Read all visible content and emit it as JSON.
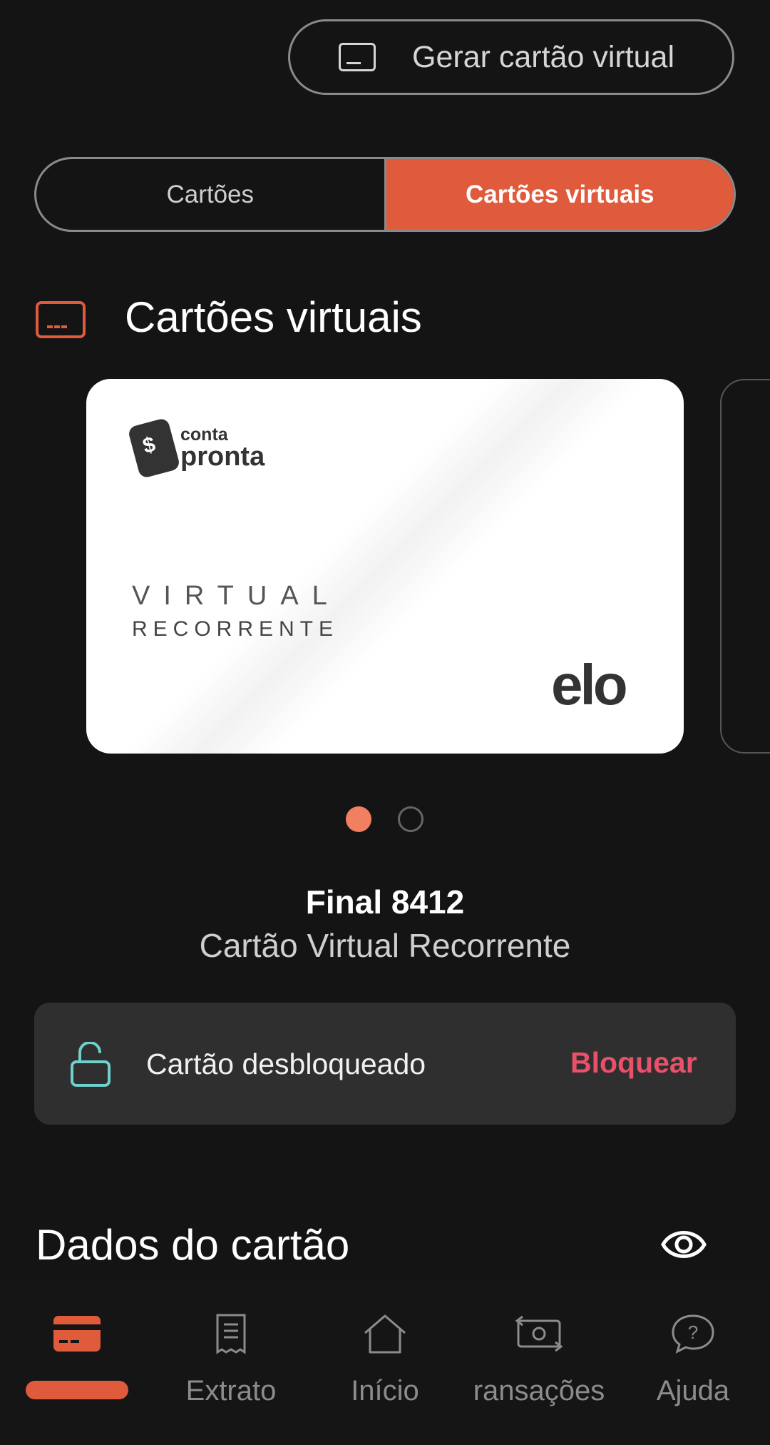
{
  "header": {
    "generate_button_label": "Gerar cartão virtual"
  },
  "tabs": [
    {
      "label": "Cartões",
      "active": false
    },
    {
      "label": "Cartões virtuais",
      "active": true
    }
  ],
  "section": {
    "title": "Cartões virtuais",
    "icon": "virtual-card-icon"
  },
  "card": {
    "logo_line1": "conta",
    "logo_line2": "pronta",
    "type_line1": "VIRTUAL",
    "type_line2": "RECORRENTE",
    "brand": "elo",
    "pagination": {
      "current": 1,
      "total": 2
    }
  },
  "card_info": {
    "final": "Final 8412",
    "name": "Cartão Virtual Recorrente"
  },
  "status": {
    "text": "Cartão desbloqueado",
    "action": "Bloquear",
    "icon": "unlocked-lock-icon"
  },
  "card_data": {
    "title": "Dados do cartão",
    "icon": "eye-icon"
  },
  "bottom_nav": {
    "items": [
      {
        "label": "",
        "icon": "card-icon",
        "active": true
      },
      {
        "label": "Extrato",
        "icon": "receipt-icon",
        "active": false
      },
      {
        "label": "Início",
        "icon": "home-icon",
        "active": false
      },
      {
        "label": "ransações",
        "icon": "money-transfer-icon",
        "active": false
      },
      {
        "label": "Ajuda",
        "icon": "help-chat-icon",
        "active": false
      }
    ]
  },
  "colors": {
    "background": "#141414",
    "accent": "#e05a3c",
    "danger": "#e9506a",
    "unlock_icon": "#6fd0cc"
  }
}
